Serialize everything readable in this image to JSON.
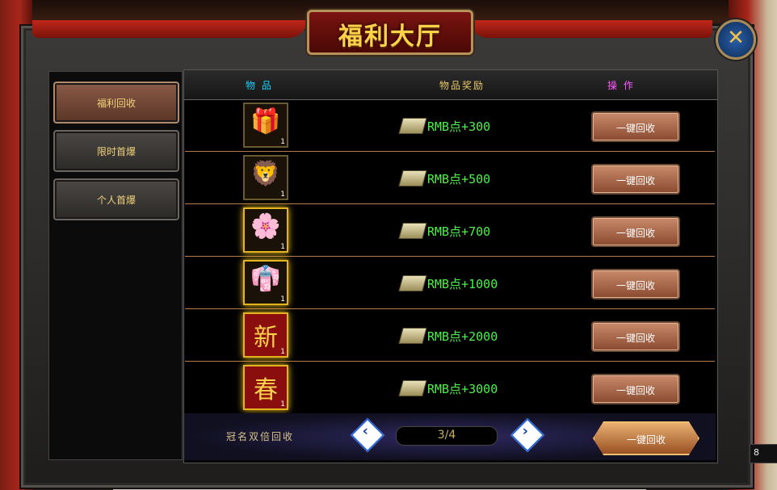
{
  "window": {
    "title": "福利大厅",
    "close_symbol": "✕"
  },
  "sidebar": {
    "items": [
      {
        "label": "福利回收",
        "active": true
      },
      {
        "label": "限时首爆",
        "active": false
      },
      {
        "label": "个人首爆",
        "active": false
      }
    ]
  },
  "table": {
    "headers": {
      "item": "物  品",
      "reward": "物品奖励",
      "action": "操  作"
    },
    "header_colors": {
      "item": "#1ad0ff",
      "reward": "#e8c86a",
      "action": "#ff5aff"
    },
    "rows": [
      {
        "icon": "gift-basket-icon",
        "glyph": "🎁",
        "count": "1",
        "reward": "RMB点+300",
        "button": "一键回收",
        "glow": false
      },
      {
        "icon": "lion-dance-head-icon",
        "glyph": "🦁",
        "count": "1",
        "reward": "RMB点+500",
        "button": "一键回收",
        "glow": false
      },
      {
        "icon": "lotus-flower-icon",
        "glyph": "🌸",
        "count": "1",
        "reward": "RMB点+700",
        "button": "一键回收",
        "glow": true
      },
      {
        "icon": "red-robe-icon",
        "glyph": "👘",
        "count": "1",
        "reward": "RMB点+1000",
        "button": "一键回收",
        "glow": true
      },
      {
        "icon": "xin-character-icon",
        "glyph": "新",
        "count": "1",
        "reward": "RMB点+2000",
        "button": "一键回收",
        "glow": true
      },
      {
        "icon": "chun-character-icon",
        "glyph": "春",
        "count": "1",
        "reward": "RMB点+3000",
        "button": "一键回收",
        "glow": true
      }
    ]
  },
  "footer": {
    "label": "冠名双倍回收",
    "prev": "‹",
    "next": "›",
    "page": "3/4",
    "all_button": "一键回收"
  },
  "corner": {
    "value": "8"
  }
}
